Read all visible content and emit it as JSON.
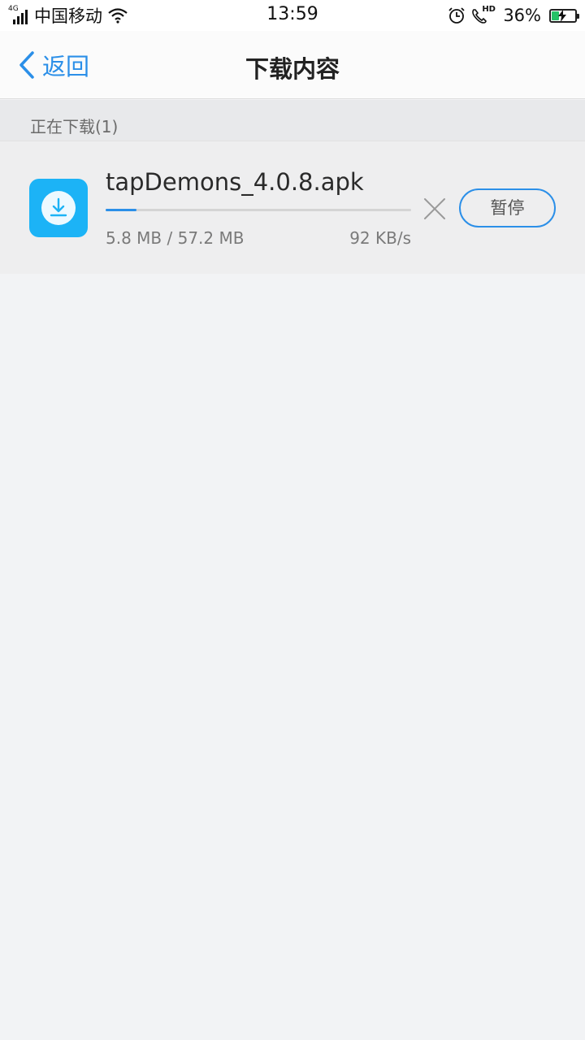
{
  "status_bar": {
    "network_type": "4G",
    "carrier": "中国移动",
    "time": "13:59",
    "hd_label": "HD",
    "battery_percent": "36%",
    "battery_level": 0.36,
    "icons": [
      "signal-icon",
      "wifi-icon",
      "alarm-icon",
      "hd-call-icon",
      "battery-charging-icon"
    ]
  },
  "nav": {
    "back_label": "返回",
    "title": "下载内容",
    "accent_color": "#2b8fe8"
  },
  "section": {
    "label": "正在下载(1)"
  },
  "downloads": [
    {
      "file_name": "tapDemons_4.0.8.apk",
      "size_text": "5.8 MB / 57.2 MB",
      "speed_text": "92 KB/s",
      "progress": 0.101,
      "pause_label": "暂停",
      "icon": "download-icon",
      "icon_color": "#1cb3f6",
      "cancel_icon": "close-icon"
    }
  ]
}
